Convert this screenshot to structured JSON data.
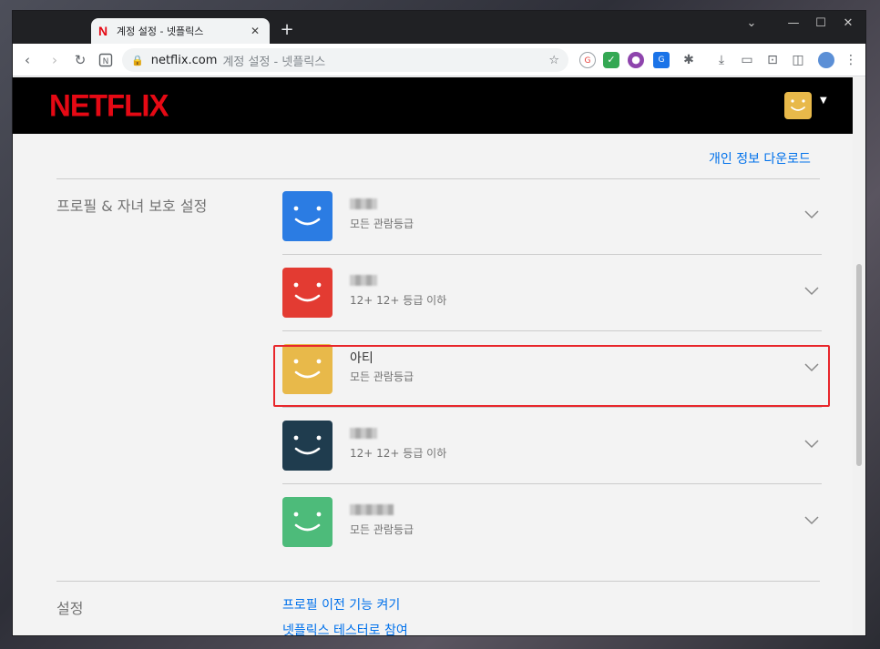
{
  "browser": {
    "tab_title": "계정 설정 - 넷플릭스",
    "tab_close": "✕",
    "new_tab": "+",
    "window_controls": {
      "dropdown": "⌄",
      "minimize": "—",
      "maximize": "☐",
      "close": "✕"
    },
    "url_host": "netflix.com",
    "url_path": "계정 설정 - 넷플릭스"
  },
  "header": {
    "logo": "NETFLIX",
    "caret": "▼"
  },
  "account": {
    "download_link": "개인 정보 다운로드"
  },
  "profiles_section": {
    "label": "프로필 & 자녀 보호 설정",
    "profiles": [
      {
        "name": "",
        "rating": "모든 관람등급",
        "color": "#2b7ce3",
        "blurred": true,
        "blur_width": 30
      },
      {
        "name": "",
        "rating": "12+ 12+ 등급 이하",
        "color": "#e33b32",
        "blurred": true,
        "blur_width": 30
      },
      {
        "name": "아티",
        "rating": "모든 관람등급",
        "color": "#e8b94a",
        "blurred": false,
        "blur_width": 0
      },
      {
        "name": "",
        "rating": "12+ 12+ 등급 이하",
        "color": "#1f3c4e",
        "blurred": true,
        "blur_width": 30
      },
      {
        "name": "",
        "rating": "모든 관람등급",
        "color": "#4dbb7a",
        "blurred": true,
        "blur_width": 48
      }
    ]
  },
  "settings_section": {
    "label": "설정",
    "link_profile_transfer": "프로필 이전 기능 켜기",
    "link_tester": "넷플릭스 테스터로 참여"
  },
  "colors": {
    "netflix_red": "#e50914",
    "link_blue": "#0071eb",
    "highlight_red": "#e8262b"
  }
}
